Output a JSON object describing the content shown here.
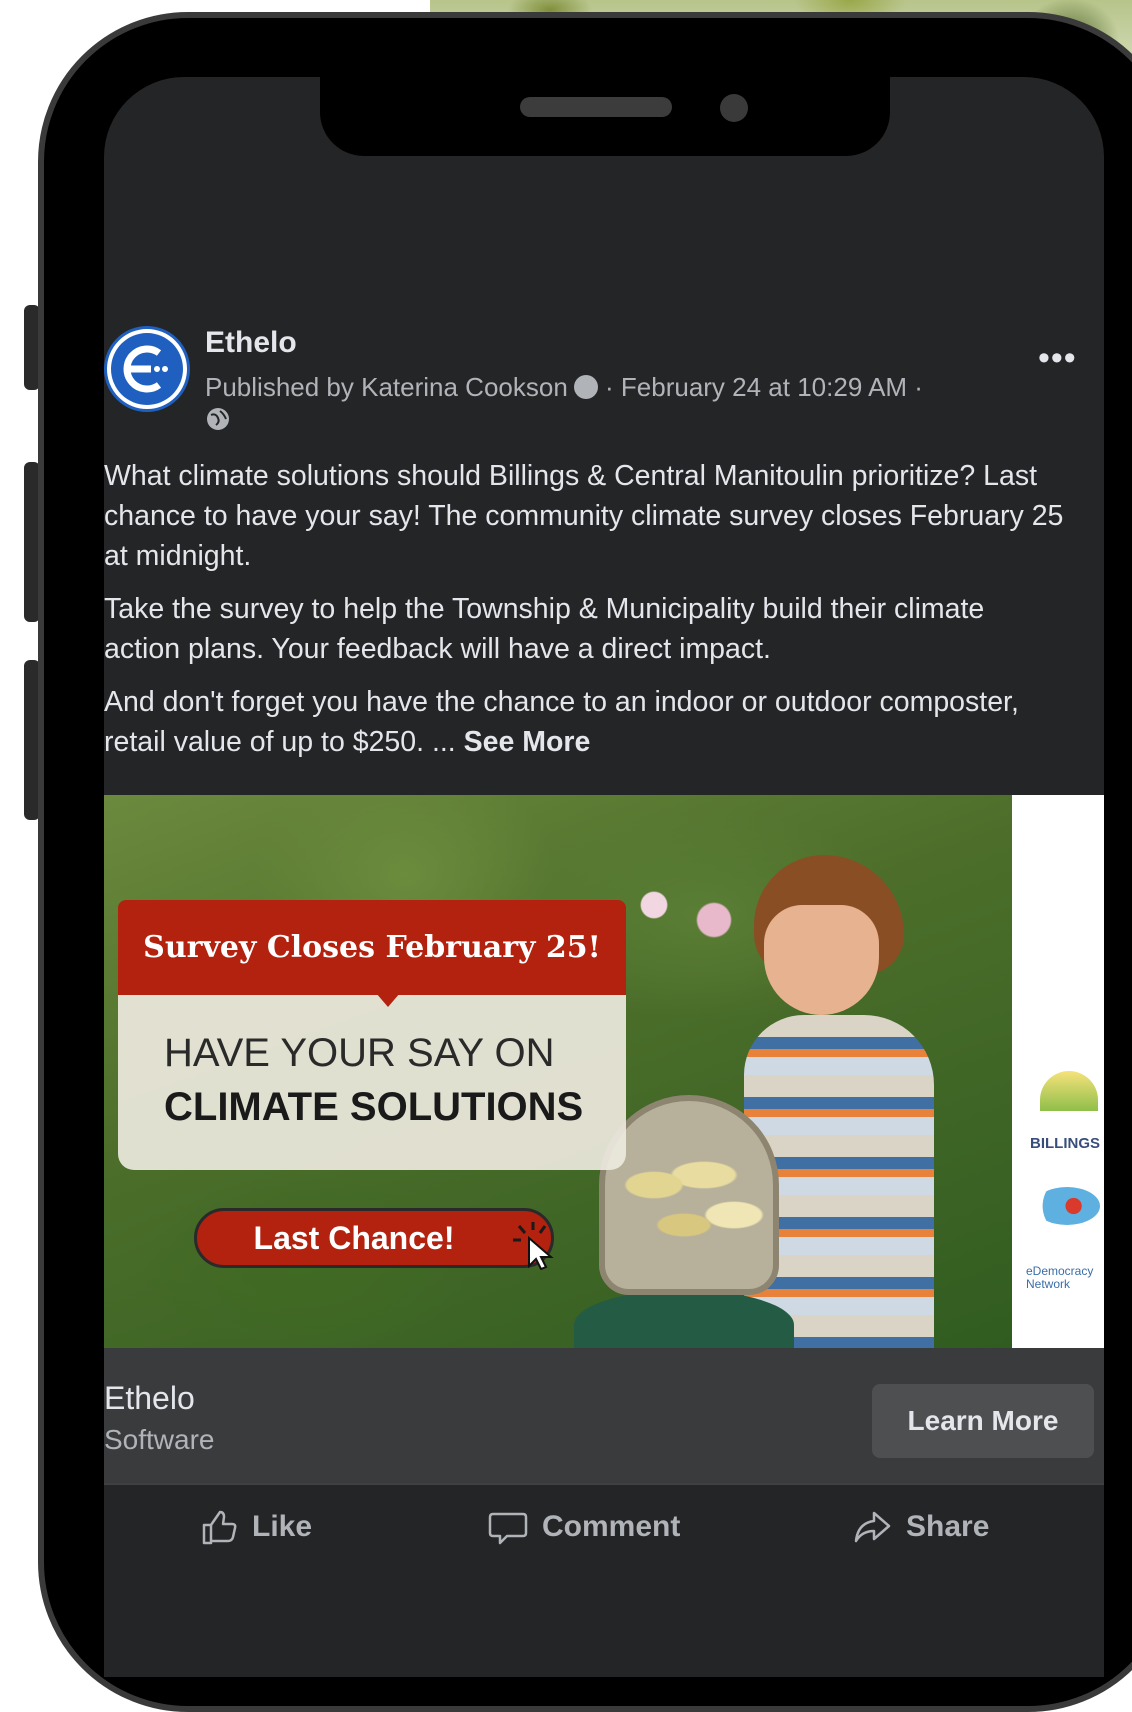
{
  "post": {
    "page_name": "Ethelo",
    "published_by": "Published by Katerina Cookson",
    "timestamp": "· February 24 at 10:29 AM ·",
    "more_label": "•••",
    "paragraphs": [
      "What climate solutions should Billings & Central Manitoulin prioritize? Last chance to have your say! The community climate survey closes February 25 at midnight.",
      "Take the survey to help the Township & Municipality build their climate action plans. Your feedback will have a direct impact.",
      "And don't forget you have the chance to an indoor or outdoor composter, retail value of up to $250. ..."
    ],
    "see_more": "See More"
  },
  "ad": {
    "banner": "Survey Closes February 25!",
    "headline_line1": "HAVE YOUR SAY ON",
    "headline_line2": "CLIMATE SOLUTIONS",
    "cta": "Last Chance!",
    "logo_text1": "BILLINGS",
    "logo_text2": "eDemocracy Network"
  },
  "link_preview": {
    "title": "Ethelo",
    "subtitle": "Software",
    "button": "Learn More"
  },
  "actions": {
    "like": "Like",
    "comment": "Comment",
    "share": "Share"
  },
  "colors": {
    "screen_bg": "#242526",
    "accent_red": "#b3210f",
    "text_primary": "#e4e6eb",
    "text_secondary": "#b0b3b8"
  },
  "icons": [
    "ethelo-logo-icon",
    "info-icon",
    "globe-icon",
    "more-icon",
    "like-icon",
    "comment-icon",
    "share-icon",
    "cursor-icon"
  ]
}
